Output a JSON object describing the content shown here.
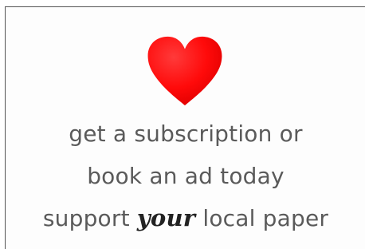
{
  "ad": {
    "heart_icon": "heart-icon",
    "heart_color": "#ff0000",
    "line1": "get a subscription or",
    "line2": "book an ad today",
    "line3_pre": "support ",
    "line3_emph": "your",
    "line3_post": " local paper"
  }
}
